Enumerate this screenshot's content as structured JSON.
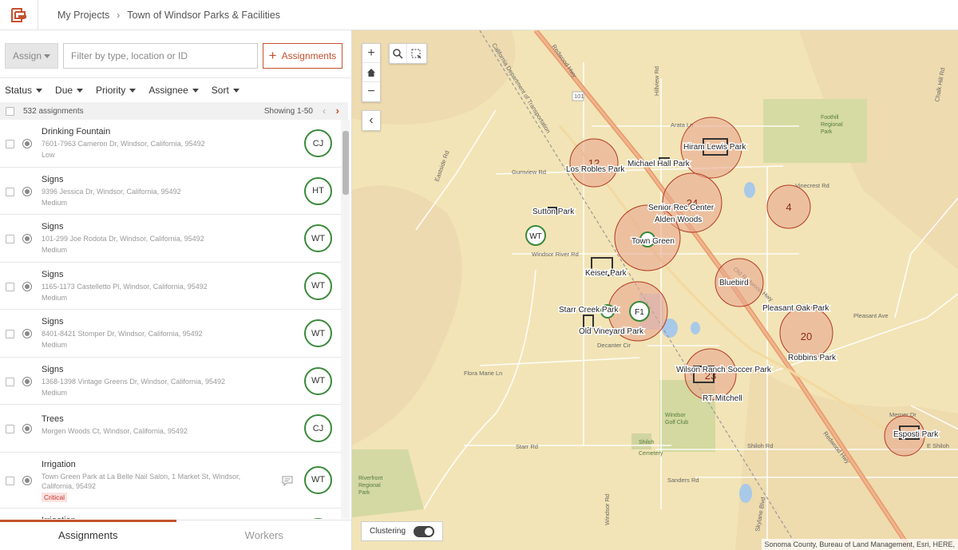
{
  "header": {
    "breadcrumbs": [
      "My Projects",
      "Town of Windsor Parks & Facilities"
    ],
    "logo_icon": "workforce-logo-icon"
  },
  "toolbar": {
    "assign_label": "Assign",
    "filter_placeholder": "Filter by type, location or ID",
    "add_button_label": "Assignments"
  },
  "filters": [
    "Status",
    "Due",
    "Priority",
    "Assignee",
    "Sort"
  ],
  "list_header": {
    "count": "532 assignments",
    "showing": "Showing 1-50"
  },
  "assignments": [
    {
      "type": "Drinking Fountain",
      "address": "7601-7963 Cameron Dr, Windsor, California, 95492",
      "priority": "Low",
      "worker": "CJ"
    },
    {
      "type": "Signs",
      "address": "9396 Jessica Dr, Windsor, California, 95492",
      "priority": "Medium",
      "worker": "HT"
    },
    {
      "type": "Signs",
      "address": "101-299 Joe Rodota Dr, Windsor, California, 95492",
      "priority": "Medium",
      "worker": "WT"
    },
    {
      "type": "Signs",
      "address": "1165-1173 Castelletto Pl, Windsor, California, 95492",
      "priority": "Medium",
      "worker": "WT"
    },
    {
      "type": "Signs",
      "address": "8401-8421 Stomper Dr, Windsor, California, 95492",
      "priority": "Medium",
      "worker": "WT"
    },
    {
      "type": "Signs",
      "address": "1368-1398 Vintage Greens Dr, Windsor, California, 95492",
      "priority": "Medium",
      "worker": "WT"
    },
    {
      "type": "Trees",
      "address": "Morgen Woods Ct, Windsor, California, 95492",
      "priority": "",
      "worker": "CJ"
    },
    {
      "type": "Irrigation",
      "address": "Town Green Park at La Belle Nail Salon, 1 Market St, Windsor,",
      "address2": "California, 95492",
      "priority": "Critical",
      "worker": "WT",
      "comment_icon": "comment-icon"
    },
    {
      "type": "Irrigation",
      "address": "",
      "priority": "",
      "worker": ""
    }
  ],
  "tabs": {
    "assignments": "Assignments",
    "workers": "Workers"
  },
  "map": {
    "clustering_label": "Clustering",
    "clustering_on": true,
    "attribution": "Sonoma County, Bureau of Land Management, Esri, HERE,",
    "clusters": [
      "12",
      "24",
      "4",
      "20",
      "23"
    ],
    "place_labels": [
      "Hiram Lewis Park",
      "Los Robles Park",
      "Michael Hall Park",
      "Senior Rec Center",
      "Alden Woods",
      "Sutton Park",
      "Town Green",
      "Keiser Park",
      "Bluebird",
      "Starr Creek Park",
      "Old Vineyard Park",
      "Pleasant Oak Park",
      "Robbins Park",
      "Wilson Ranch Soccer Park",
      "RT Mitchell",
      "Esposti Park"
    ],
    "workers": [
      "WT",
      "F1"
    ],
    "road_labels": [
      "Arata Ln",
      "Gumview Rd",
      "Vinecrest Rd",
      "Windsor River Rd",
      "Pleasant Ave",
      "Decanter Cir",
      "Flora Marie Ln",
      "Starr Rd",
      "Shiloh Rd",
      "Sanders Rd",
      "Merner Dr",
      "E Shiloh",
      "Hillview Rd",
      "Eastside Rd",
      "Chalk Hill Rd",
      "Windsor Rd",
      "Skylane Blvd",
      "Redwood Hwy",
      "101",
      "Foothill Regional Park",
      "Riverfront Regional Park",
      "Windsor Golf Club",
      "Shiloh Cemetery",
      "Old Redwood Hwy",
      "California Department of Transportation"
    ]
  },
  "colors": {
    "accent": "#c3522e",
    "worker_ring": "#3a8a3a",
    "cluster_fill": "#e7a98f",
    "cluster_stroke": "#b23a22"
  }
}
